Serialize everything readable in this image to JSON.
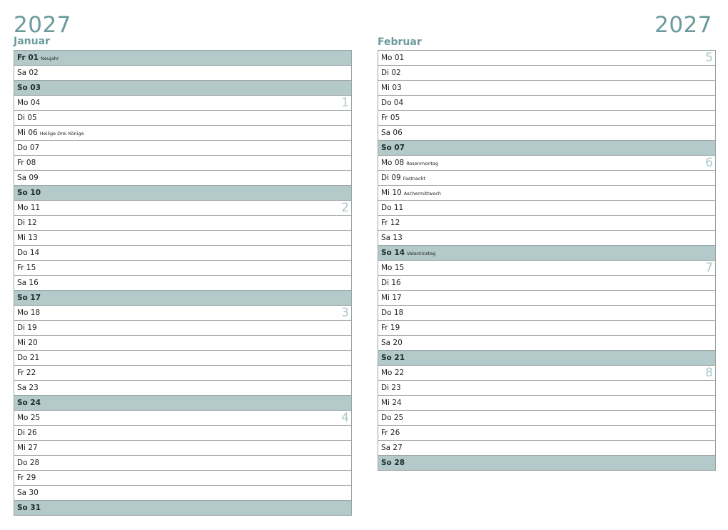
{
  "year_left": "2027",
  "year_right": "2027",
  "months": [
    {
      "name": "Januar",
      "days": [
        {
          "label": "Fr 01",
          "holiday": "Neujahr",
          "sunday": true,
          "week": ""
        },
        {
          "label": "Sa 02",
          "holiday": "",
          "sunday": false,
          "week": ""
        },
        {
          "label": "So 03",
          "holiday": "",
          "sunday": true,
          "week": ""
        },
        {
          "label": "Mo 04",
          "holiday": "",
          "sunday": false,
          "week": "1"
        },
        {
          "label": "Di 05",
          "holiday": "",
          "sunday": false,
          "week": ""
        },
        {
          "label": "Mi 06",
          "holiday": "Heilige Drei Könige",
          "sunday": false,
          "week": ""
        },
        {
          "label": "Do 07",
          "holiday": "",
          "sunday": false,
          "week": ""
        },
        {
          "label": "Fr 08",
          "holiday": "",
          "sunday": false,
          "week": ""
        },
        {
          "label": "Sa 09",
          "holiday": "",
          "sunday": false,
          "week": ""
        },
        {
          "label": "So 10",
          "holiday": "",
          "sunday": true,
          "week": ""
        },
        {
          "label": "Mo 11",
          "holiday": "",
          "sunday": false,
          "week": "2"
        },
        {
          "label": "Di 12",
          "holiday": "",
          "sunday": false,
          "week": ""
        },
        {
          "label": "Mi 13",
          "holiday": "",
          "sunday": false,
          "week": ""
        },
        {
          "label": "Do 14",
          "holiday": "",
          "sunday": false,
          "week": ""
        },
        {
          "label": "Fr 15",
          "holiday": "",
          "sunday": false,
          "week": ""
        },
        {
          "label": "Sa 16",
          "holiday": "",
          "sunday": false,
          "week": ""
        },
        {
          "label": "So 17",
          "holiday": "",
          "sunday": true,
          "week": ""
        },
        {
          "label": "Mo 18",
          "holiday": "",
          "sunday": false,
          "week": "3"
        },
        {
          "label": "Di 19",
          "holiday": "",
          "sunday": false,
          "week": ""
        },
        {
          "label": "Mi 20",
          "holiday": "",
          "sunday": false,
          "week": ""
        },
        {
          "label": "Do 21",
          "holiday": "",
          "sunday": false,
          "week": ""
        },
        {
          "label": "Fr 22",
          "holiday": "",
          "sunday": false,
          "week": ""
        },
        {
          "label": "Sa 23",
          "holiday": "",
          "sunday": false,
          "week": ""
        },
        {
          "label": "So 24",
          "holiday": "",
          "sunday": true,
          "week": ""
        },
        {
          "label": "Mo 25",
          "holiday": "",
          "sunday": false,
          "week": "4"
        },
        {
          "label": "Di 26",
          "holiday": "",
          "sunday": false,
          "week": ""
        },
        {
          "label": "Mi 27",
          "holiday": "",
          "sunday": false,
          "week": ""
        },
        {
          "label": "Do 28",
          "holiday": "",
          "sunday": false,
          "week": ""
        },
        {
          "label": "Fr 29",
          "holiday": "",
          "sunday": false,
          "week": ""
        },
        {
          "label": "Sa 30",
          "holiday": "",
          "sunday": false,
          "week": ""
        },
        {
          "label": "So 31",
          "holiday": "",
          "sunday": true,
          "week": ""
        }
      ]
    },
    {
      "name": "Februar",
      "days": [
        {
          "label": "Mo 01",
          "holiday": "",
          "sunday": false,
          "week": "5"
        },
        {
          "label": "Di 02",
          "holiday": "",
          "sunday": false,
          "week": ""
        },
        {
          "label": "Mi 03",
          "holiday": "",
          "sunday": false,
          "week": ""
        },
        {
          "label": "Do 04",
          "holiday": "",
          "sunday": false,
          "week": ""
        },
        {
          "label": "Fr 05",
          "holiday": "",
          "sunday": false,
          "week": ""
        },
        {
          "label": "Sa 06",
          "holiday": "",
          "sunday": false,
          "week": ""
        },
        {
          "label": "So 07",
          "holiday": "",
          "sunday": true,
          "week": ""
        },
        {
          "label": "Mo 08",
          "holiday": "Rosenmontag",
          "sunday": false,
          "week": "6"
        },
        {
          "label": "Di 09",
          "holiday": "Fastnacht",
          "sunday": false,
          "week": ""
        },
        {
          "label": "Mi 10",
          "holiday": "Aschermittwoch",
          "sunday": false,
          "week": ""
        },
        {
          "label": "Do 11",
          "holiday": "",
          "sunday": false,
          "week": ""
        },
        {
          "label": "Fr 12",
          "holiday": "",
          "sunday": false,
          "week": ""
        },
        {
          "label": "Sa 13",
          "holiday": "",
          "sunday": false,
          "week": ""
        },
        {
          "label": "So 14",
          "holiday": "Valentinstag",
          "sunday": true,
          "week": ""
        },
        {
          "label": "Mo 15",
          "holiday": "",
          "sunday": false,
          "week": "7"
        },
        {
          "label": "Di 16",
          "holiday": "",
          "sunday": false,
          "week": ""
        },
        {
          "label": "Mi 17",
          "holiday": "",
          "sunday": false,
          "week": ""
        },
        {
          "label": "Do 18",
          "holiday": "",
          "sunday": false,
          "week": ""
        },
        {
          "label": "Fr 19",
          "holiday": "",
          "sunday": false,
          "week": ""
        },
        {
          "label": "Sa 20",
          "holiday": "",
          "sunday": false,
          "week": ""
        },
        {
          "label": "So 21",
          "holiday": "",
          "sunday": true,
          "week": ""
        },
        {
          "label": "Mo 22",
          "holiday": "",
          "sunday": false,
          "week": "8"
        },
        {
          "label": "Di 23",
          "holiday": "",
          "sunday": false,
          "week": ""
        },
        {
          "label": "Mi 24",
          "holiday": "",
          "sunday": false,
          "week": ""
        },
        {
          "label": "Do 25",
          "holiday": "",
          "sunday": false,
          "week": ""
        },
        {
          "label": "Fr 26",
          "holiday": "",
          "sunday": false,
          "week": ""
        },
        {
          "label": "Sa 27",
          "holiday": "",
          "sunday": false,
          "week": ""
        },
        {
          "label": "So 28",
          "holiday": "",
          "sunday": true,
          "week": ""
        }
      ]
    }
  ],
  "colors": {
    "accent": "#6b9a9c",
    "sunday_row": "#b3c9ca",
    "week_number": "#a9c7c8",
    "grid_line": "#9aa3a4"
  }
}
